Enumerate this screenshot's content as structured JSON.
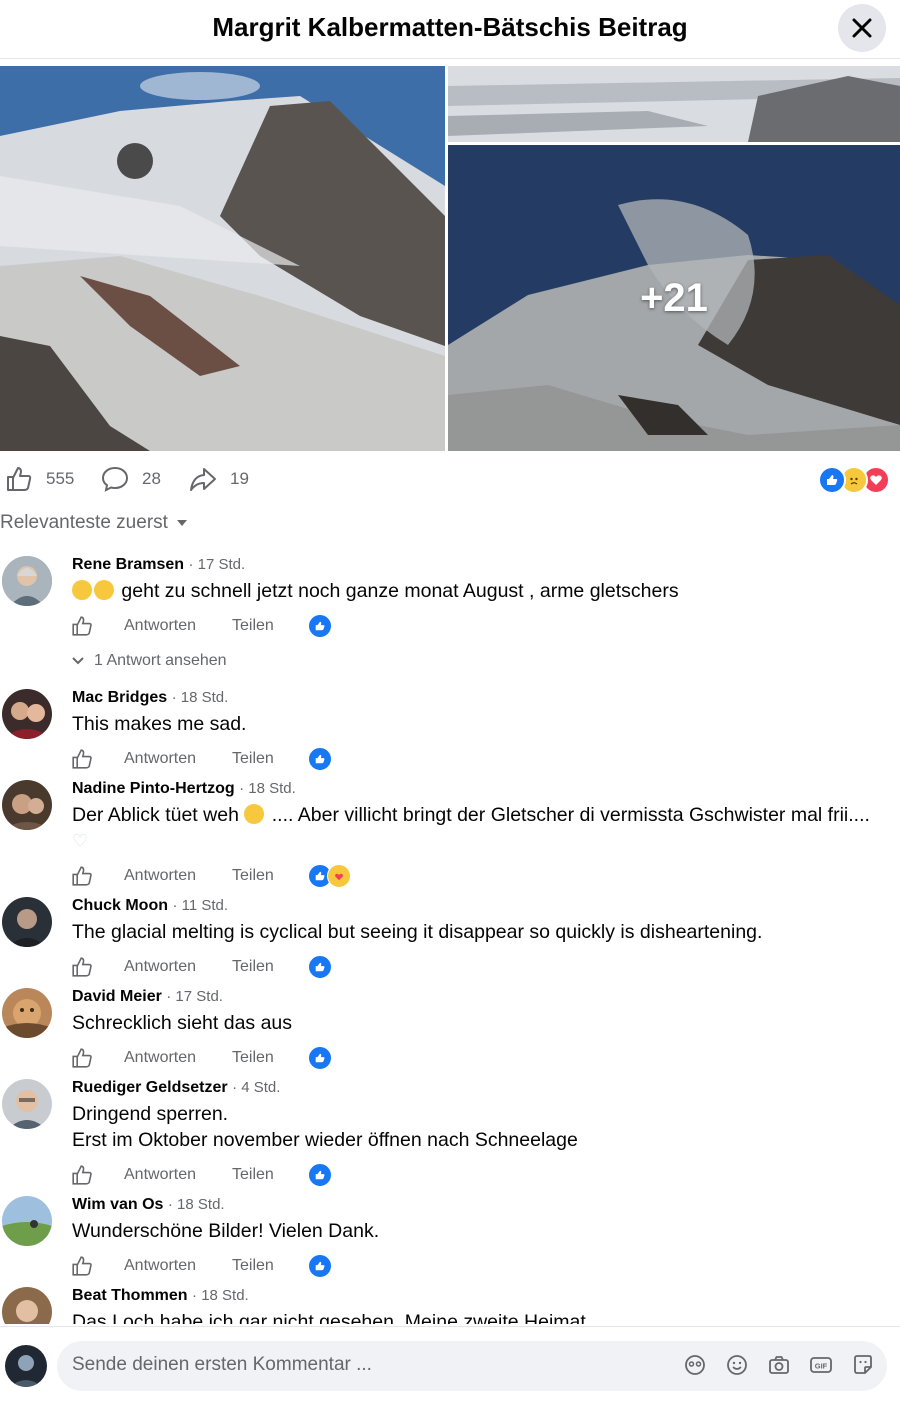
{
  "header": {
    "title": "Margrit Kalbermatten-Bätschis Beitrag"
  },
  "photos": {
    "more_count": "+21"
  },
  "stats": {
    "likes": "555",
    "comments": "28",
    "shares": "19"
  },
  "sort": {
    "label": "Relevanteste zuerst"
  },
  "actions": {
    "reply": "Antworten",
    "share": "Teilen"
  },
  "comments": [
    {
      "name": "Rene Bramsen",
      "time": "· 17 Std.",
      "text": "geht zu schnell jetzt noch ganze monat August , arme gletschers",
      "replies": "1 Antwort ansehen"
    },
    {
      "name": "Mac Bridges",
      "time": "· 18 Std.",
      "text": "This makes me sad."
    },
    {
      "name": "Nadine Pinto-Hertzog",
      "time": "· 18 Std.",
      "text_a": "Der Ablick tüet weh",
      "text_b": ".... Aber villicht bringt der Gletscher di vermissta Gschwister mal frii...."
    },
    {
      "name": "Chuck Moon",
      "time": "· 11 Std.",
      "text": "The glacial melting is cyclical but seeing it disappear so quickly is disheartening."
    },
    {
      "name": "David Meier",
      "time": "· 17 Std.",
      "text": "Schrecklich sieht das aus"
    },
    {
      "name": "Ruediger Geldsetzer",
      "time": "· 4 Std.",
      "line1": "Dringend sperren.",
      "line2": "Erst im Oktober november wieder öffnen nach Schneelage"
    },
    {
      "name": "Wim van Os",
      "time": "· 18 Std.",
      "text": "Wunderschöne Bilder! Vielen Dank."
    },
    {
      "name": "Beat Thommen",
      "time": "· 18 Std.",
      "text": "Das Loch habe ich gar nicht gesehen. Meine zweite Heimat"
    }
  ],
  "composer": {
    "placeholder": "Sende deinen ersten Kommentar ..."
  },
  "colors": {
    "facebook_blue": "#1877f2",
    "love_red": "#f33e58",
    "text_secondary": "#65676b"
  }
}
